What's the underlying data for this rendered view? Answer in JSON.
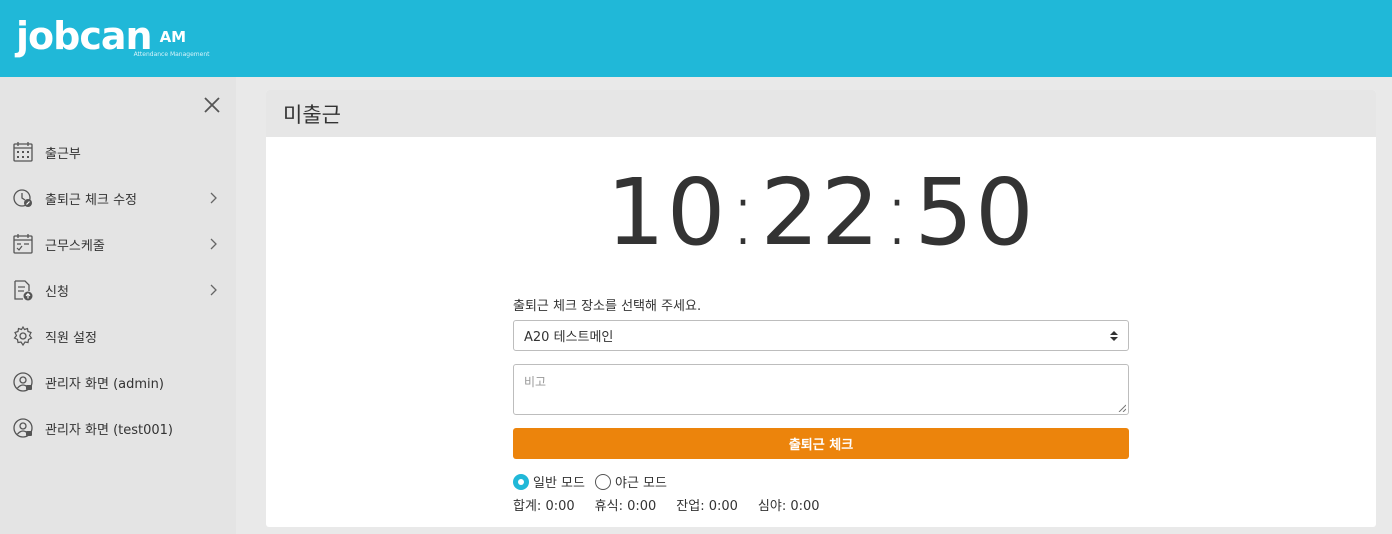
{
  "header": {
    "brand": "jobcan",
    "brand_suffix": "AM",
    "brand_sub": "Attendance Management",
    "bg": "#20b8d8"
  },
  "sidebar": {
    "items": [
      {
        "label": "출근부",
        "icon": "calendar-grid-icon",
        "has_submenu": false
      },
      {
        "label": "출퇴근 체크 수정",
        "icon": "clock-edit-icon",
        "has_submenu": true
      },
      {
        "label": "근무스케줄",
        "icon": "schedule-icon",
        "has_submenu": true
      },
      {
        "label": "신청",
        "icon": "document-upload-icon",
        "has_submenu": true
      },
      {
        "label": "직원 설정",
        "icon": "gear-icon",
        "has_submenu": false
      },
      {
        "label": "관리자 화면 (admin)",
        "icon": "admin-user-icon",
        "has_submenu": false
      },
      {
        "label": "관리자 화면 (test001)",
        "icon": "admin-user-icon",
        "has_submenu": false
      }
    ]
  },
  "panel": {
    "title": "미출근",
    "clock": {
      "hh": "10",
      "mm": "22",
      "ss": "50"
    },
    "place_label": "출퇴근 체크 장소를 선택해 주세요.",
    "place_selected": "A20 테스트메인",
    "note_placeholder": "비고",
    "check_button": "출퇴근 체크",
    "accent": "#ec840c",
    "modes": [
      {
        "label": "일반 모드",
        "selected": true
      },
      {
        "label": "야근 모드",
        "selected": false
      }
    ],
    "totals": [
      {
        "label": "합계",
        "value": "0:00"
      },
      {
        "label": "휴식",
        "value": "0:00"
      },
      {
        "label": "잔업",
        "value": "0:00"
      },
      {
        "label": "심야",
        "value": "0:00"
      }
    ]
  }
}
